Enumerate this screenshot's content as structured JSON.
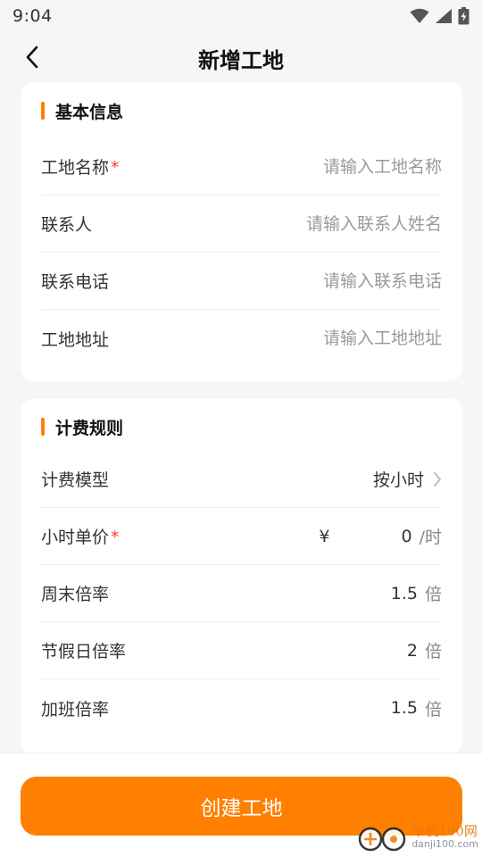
{
  "status_bar": {
    "time": "9:04"
  },
  "header": {
    "title": "新增工地",
    "back_icon": "chevron-left-icon"
  },
  "colors": {
    "accent": "#ff7f00",
    "required": "#ff3b30",
    "background": "#f5f6f8"
  },
  "basic_info": {
    "title": "基本信息",
    "rows": [
      {
        "label": "工地名称",
        "required_mark": "*",
        "placeholder": "请输入工地名称",
        "value": ""
      },
      {
        "label": "联系人",
        "placeholder": "请输入联系人姓名",
        "value": ""
      },
      {
        "label": "联系电话",
        "placeholder": "请输入联系电话",
        "value": ""
      },
      {
        "label": "工地地址",
        "placeholder": "请输入工地地址",
        "value": ""
      }
    ]
  },
  "billing": {
    "title": "计费规则",
    "model": {
      "label": "计费模型",
      "value": "按小时"
    },
    "hourly_price": {
      "label": "小时单价",
      "required_mark": "*",
      "currency": "¥",
      "value": "0",
      "unit": "/时"
    },
    "weekend_rate": {
      "label": "周末倍率",
      "value": "1.5",
      "unit": "倍"
    },
    "holiday_rate": {
      "label": "节假日倍率",
      "value": "2",
      "unit": "倍"
    },
    "overtime_rate": {
      "label": "加班倍率",
      "value": "1.5",
      "unit": "倍"
    }
  },
  "footer": {
    "create_button": "创建工地"
  },
  "watermark": {
    "name": "单机100网",
    "url": "danji100.com"
  }
}
